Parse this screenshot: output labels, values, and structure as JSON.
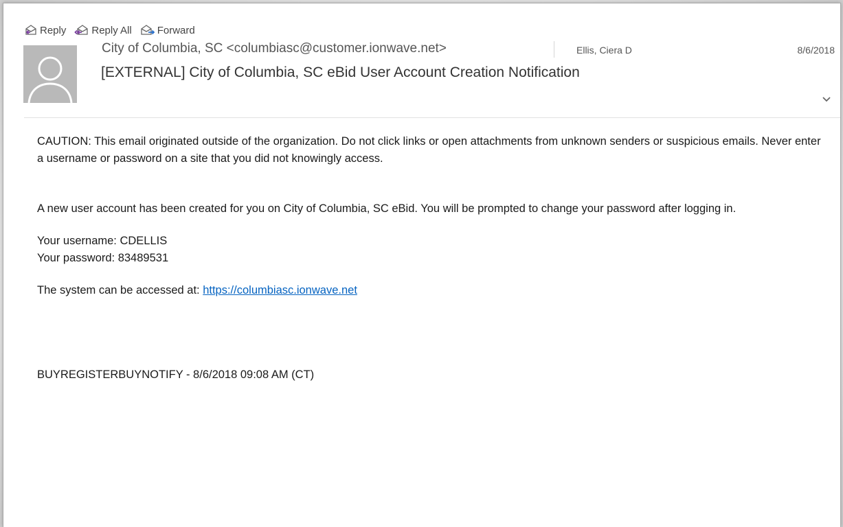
{
  "toolbar": {
    "reply_label": "Reply",
    "reply_all_label": "Reply All",
    "forward_label": "Forward"
  },
  "header": {
    "from": "City of Columbia, SC <columbiasc@customer.ionwave.net>",
    "to": "Ellis, Ciera D",
    "date": "8/6/2018",
    "subject": "[EXTERNAL] City of Columbia, SC eBid User Account Creation Notification"
  },
  "body": {
    "caution": "CAUTION: This email originated outside of the organization. Do not click links or open attachments from unknown senders or suspicious emails. Never enter a username or password on a site that you did not knowingly access.",
    "intro": "A new user account has been created for you on City of Columbia, SC eBid. You will be prompted to change your password after logging in.",
    "username_line": "Your username: CDELLIS",
    "password_line": "Your password: 83489531",
    "access_prefix": "The system can be accessed at: ",
    "access_link": "https://columbiasc.ionwave.net",
    "footer": "BUYREGISTERBUYNOTIFY - 8/6/2018 09:08 AM (CT)"
  },
  "colors": {
    "link": "#0563c1",
    "reply_arrow": "#7b3fa0",
    "forward_arrow": "#2a6fc9",
    "avatar_bg": "#b9b9b9"
  },
  "icons": {
    "reply": "reply-icon",
    "reply_all": "reply-all-icon",
    "forward": "forward-icon",
    "avatar": "person-silhouette-icon",
    "expand": "chevron-down-icon"
  }
}
